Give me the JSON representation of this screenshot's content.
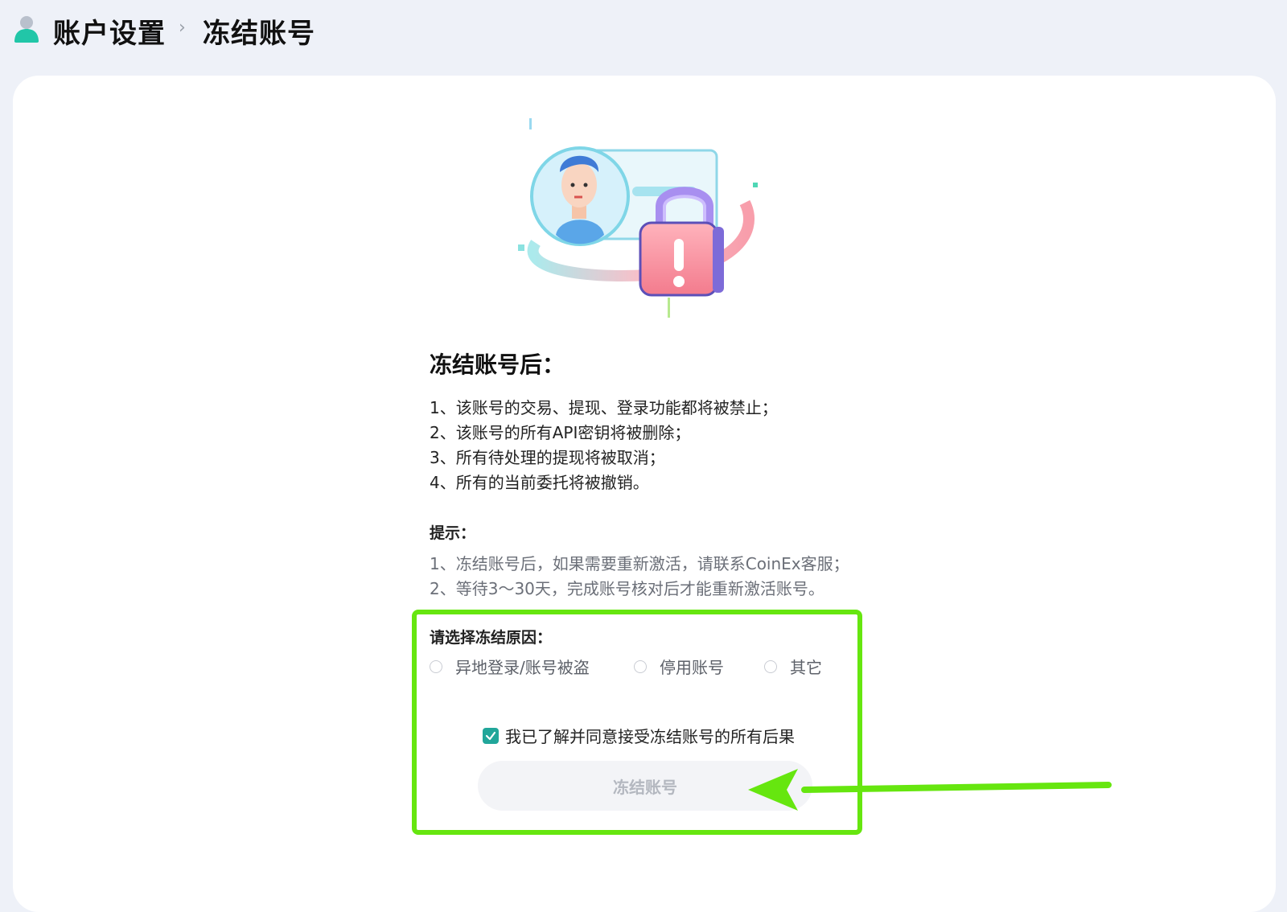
{
  "breadcrumb": {
    "root": "账户设置",
    "separator": "›",
    "current": "冻结账号"
  },
  "icons": {
    "user": "user-icon",
    "illustration": "locked-account-illustration",
    "check": "check-icon",
    "arrow": "arrow-left-annotation"
  },
  "notice": {
    "title": "冻结账号后：",
    "items": [
      "1、该账号的交易、提现、登录功能都将被禁止；",
      "2、该账号的所有API密钥将被删除；",
      "3、所有待处理的提现将被取消；",
      "4、所有的当前委托将被撤销。"
    ]
  },
  "tips": {
    "title": "提示：",
    "items": [
      "1、冻结账号后，如果需要重新激活，请联系CoinEx客服；",
      "2、等待3～30天，完成账号核对后才能重新激活账号。"
    ]
  },
  "reason": {
    "title": "请选择冻结原因：",
    "options": [
      "异地登录/账号被盗",
      "停用账号",
      "其它"
    ]
  },
  "agreement": {
    "label": "我已了解并同意接受冻结账号的所有后果",
    "checked": true
  },
  "submit": {
    "label": "冻结账号",
    "disabled": true
  },
  "colors": {
    "accent": "#21a69a",
    "highlight": "#66e60f",
    "background": "#eef1f8"
  }
}
